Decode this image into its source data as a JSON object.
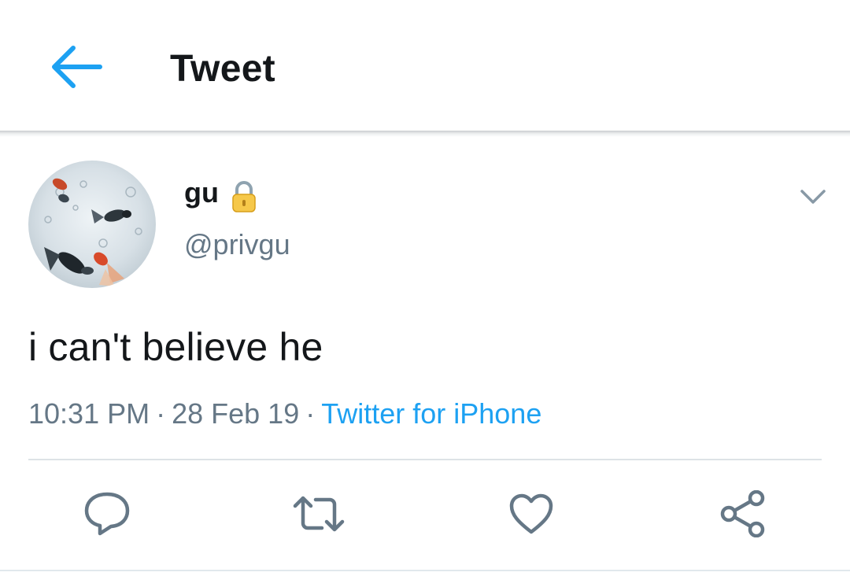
{
  "header": {
    "title": "Tweet",
    "back_icon": "arrow-left-icon",
    "accent_color": "#1da1f2"
  },
  "author": {
    "name": "gu",
    "handle": "@privgu",
    "protected_icon": "lock-icon",
    "menu_icon": "chevron-down-icon"
  },
  "tweet": {
    "text": "i can't believe he",
    "time": "10:31 PM",
    "date": "28 Feb 19",
    "separator": "·",
    "source": "Twitter for iPhone"
  },
  "actions": [
    {
      "icon": "reply-icon"
    },
    {
      "icon": "retweet-icon"
    },
    {
      "icon": "like-icon"
    },
    {
      "icon": "share-icon"
    }
  ],
  "colors": {
    "text_primary": "#14171a",
    "text_secondary": "#657786",
    "link": "#1da1f2",
    "icon_gray": "#657786"
  }
}
